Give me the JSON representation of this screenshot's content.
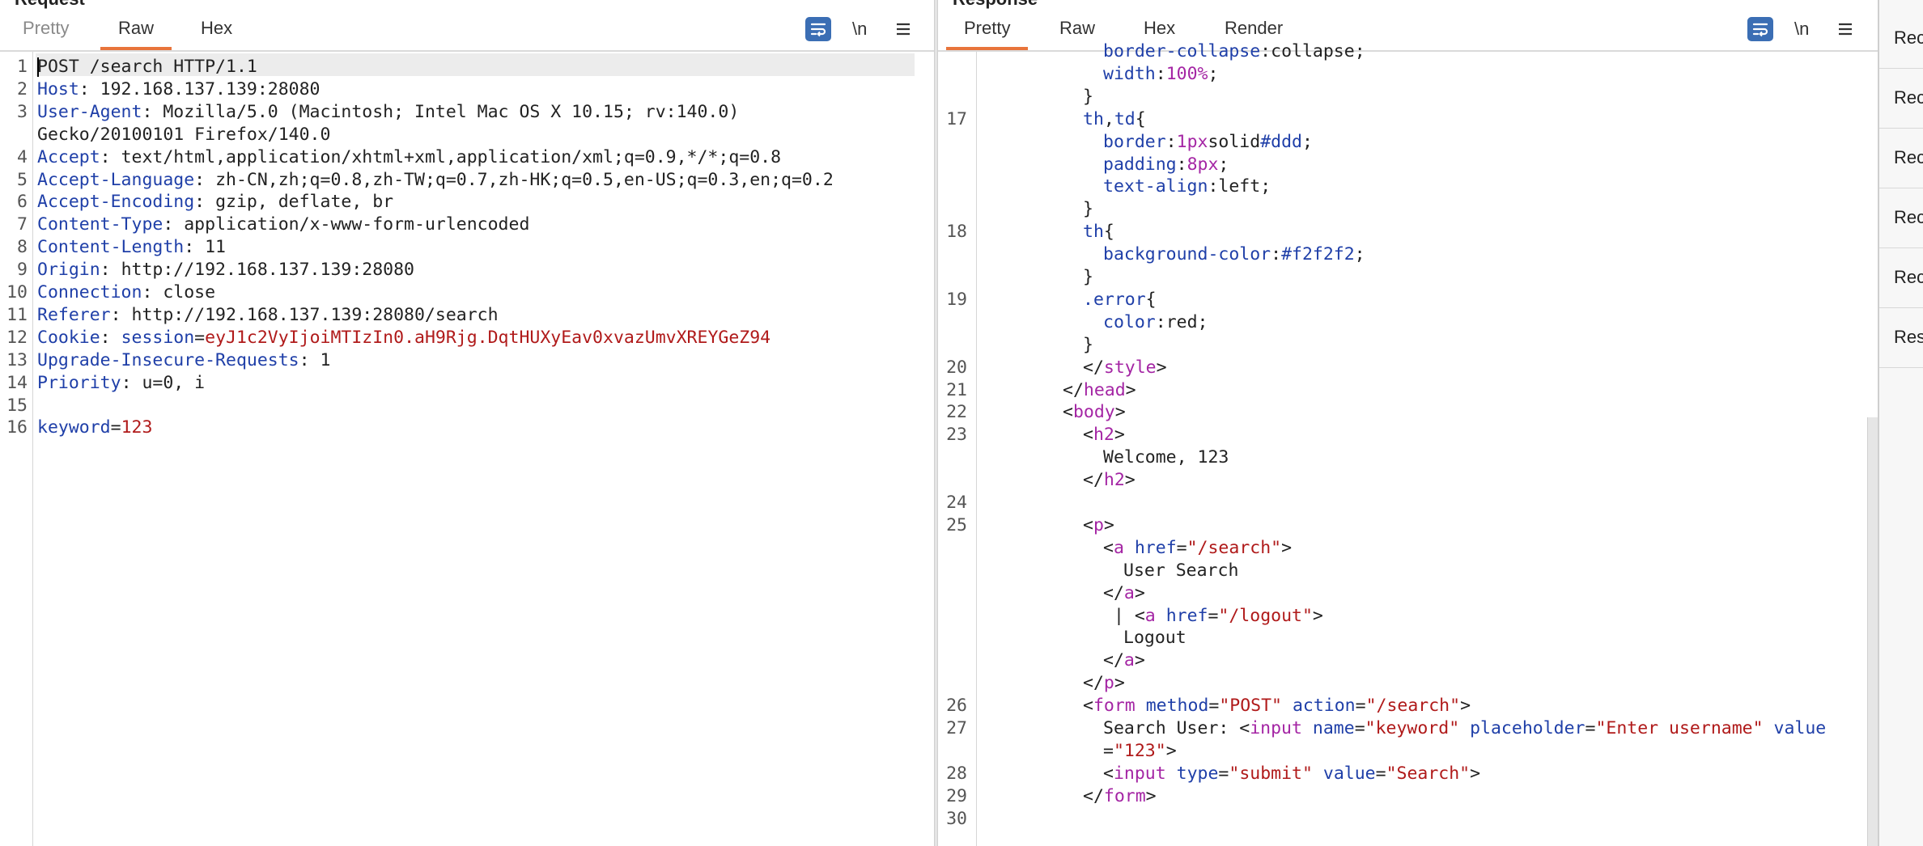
{
  "request": {
    "title": "Request",
    "tabs": [
      {
        "label": "Pretty",
        "active": false
      },
      {
        "label": "Raw",
        "active": true
      },
      {
        "label": "Hex",
        "active": false
      }
    ],
    "toolbar": {
      "wrap_icon": "wrap-lines-icon",
      "newline_label": "\\n",
      "menu_icon": "hamburger-menu-icon"
    },
    "lines": [
      {
        "n": "1",
        "text": "POST /search HTTP/1.1"
      },
      {
        "n": "2",
        "key": "Host",
        "value": "192.168.137.139:28080"
      },
      {
        "n": "3",
        "key": "User-Agent",
        "value": "Mozilla/5.0 (Macintosh; Intel Mac OS X 10.15; rv:140.0)"
      },
      {
        "n": "",
        "text": "Gecko/20100101 Firefox/140.0"
      },
      {
        "n": "4",
        "key": "Accept",
        "value": "text/html,application/xhtml+xml,application/xml;q=0.9,*/*;q=0.8"
      },
      {
        "n": "5",
        "key": "Accept-Language",
        "value": "zh-CN,zh;q=0.8,zh-TW;q=0.7,zh-HK;q=0.5,en-US;q=0.3,en;q=0.2"
      },
      {
        "n": "6",
        "key": "Accept-Encoding",
        "value": "gzip, deflate, br"
      },
      {
        "n": "7",
        "key": "Content-Type",
        "value": "application/x-www-form-urlencoded"
      },
      {
        "n": "8",
        "key": "Content-Length",
        "value": "11"
      },
      {
        "n": "9",
        "key": "Origin",
        "value": "http://192.168.137.139:28080"
      },
      {
        "n": "10",
        "key": "Connection",
        "value": "close"
      },
      {
        "n": "11",
        "key": "Referer",
        "value": "http://192.168.137.139:28080/search"
      },
      {
        "n": "12",
        "key": "Cookie",
        "cookie_name": "session",
        "cookie_value": "eyJ1c2VyIjoiMTIzIn0.aH9Rjg.DqtHUXyEav0xvazUmvXREYGeZ94"
      },
      {
        "n": "13",
        "key": "Upgrade-Insecure-Requests",
        "value": "1"
      },
      {
        "n": "14",
        "key": "Priority",
        "value": "u=0, i"
      },
      {
        "n": "15",
        "text": ""
      },
      {
        "n": "16",
        "param_name": "keyword",
        "param_value": "123"
      }
    ]
  },
  "response": {
    "title": "Response",
    "tabs": [
      {
        "label": "Pretty",
        "active": true
      },
      {
        "label": "Raw",
        "active": false
      },
      {
        "label": "Hex",
        "active": false
      },
      {
        "label": "Render",
        "active": false
      }
    ],
    "toolbar": {
      "wrap_icon": "wrap-lines-icon",
      "newline_label": "\\n",
      "menu_icon": "hamburger-menu-icon"
    },
    "lines": [
      {
        "n": "",
        "ind": 6,
        "parts": [
          [
            "p",
            "border-collapse"
          ],
          [
            "x",
            ":"
          ],
          [
            "v",
            "collapse"
          ],
          [
            "x",
            ";"
          ]
        ]
      },
      {
        "n": "",
        "ind": 6,
        "parts": [
          [
            "p",
            "width"
          ],
          [
            "x",
            ":"
          ],
          [
            "m",
            "100%"
          ],
          [
            "x",
            ";"
          ]
        ]
      },
      {
        "n": "",
        "ind": 5,
        "parts": [
          [
            "x",
            "}"
          ]
        ]
      },
      {
        "n": "17",
        "ind": 5,
        "parts": [
          [
            "s",
            "th"
          ],
          [
            "x",
            ","
          ],
          [
            "s",
            "td"
          ],
          [
            "x",
            "{"
          ]
        ]
      },
      {
        "n": "",
        "ind": 6,
        "parts": [
          [
            "p",
            "border"
          ],
          [
            "x",
            ":"
          ],
          [
            "m",
            "1px"
          ],
          [
            "v",
            "solid"
          ],
          [
            "h",
            "#ddd"
          ],
          [
            "x",
            ";"
          ]
        ]
      },
      {
        "n": "",
        "ind": 6,
        "parts": [
          [
            "p",
            "padding"
          ],
          [
            "x",
            ":"
          ],
          [
            "m",
            "8px"
          ],
          [
            "x",
            ";"
          ]
        ]
      },
      {
        "n": "",
        "ind": 6,
        "parts": [
          [
            "p",
            "text-align"
          ],
          [
            "x",
            ":"
          ],
          [
            "v",
            "left"
          ],
          [
            "x",
            ";"
          ]
        ]
      },
      {
        "n": "",
        "ind": 5,
        "parts": [
          [
            "x",
            "}"
          ]
        ]
      },
      {
        "n": "18",
        "ind": 5,
        "parts": [
          [
            "s",
            "th"
          ],
          [
            "x",
            "{"
          ]
        ]
      },
      {
        "n": "",
        "ind": 6,
        "parts": [
          [
            "p",
            "background-color"
          ],
          [
            "x",
            ":"
          ],
          [
            "h",
            "#f2f2f2"
          ],
          [
            "x",
            ";"
          ]
        ]
      },
      {
        "n": "",
        "ind": 5,
        "parts": [
          [
            "x",
            "}"
          ]
        ]
      },
      {
        "n": "19",
        "ind": 5,
        "parts": [
          [
            "s",
            ".error"
          ],
          [
            "x",
            "{"
          ]
        ]
      },
      {
        "n": "",
        "ind": 6,
        "parts": [
          [
            "p",
            "color"
          ],
          [
            "x",
            ":"
          ],
          [
            "v",
            "red"
          ],
          [
            "x",
            ";"
          ]
        ]
      },
      {
        "n": "",
        "ind": 5,
        "parts": [
          [
            "x",
            "}"
          ]
        ]
      },
      {
        "n": "20",
        "ind": 5,
        "parts": [
          [
            "x",
            "</"
          ],
          [
            "t",
            "style"
          ],
          [
            "x",
            ">"
          ]
        ]
      },
      {
        "n": "21",
        "ind": 4,
        "parts": [
          [
            "x",
            "</"
          ],
          [
            "t",
            "head"
          ],
          [
            "x",
            ">"
          ]
        ]
      },
      {
        "n": "22",
        "ind": 4,
        "parts": [
          [
            "x",
            "<"
          ],
          [
            "t",
            "body"
          ],
          [
            "x",
            ">"
          ]
        ]
      },
      {
        "n": "23",
        "ind": 5,
        "parts": [
          [
            "x",
            "<"
          ],
          [
            "t",
            "h2"
          ],
          [
            "x",
            ">"
          ]
        ]
      },
      {
        "n": "",
        "ind": 6,
        "parts": [
          [
            "x",
            "Welcome, 123"
          ]
        ]
      },
      {
        "n": "",
        "ind": 5,
        "parts": [
          [
            "x",
            "</"
          ],
          [
            "t",
            "h2"
          ],
          [
            "x",
            ">"
          ]
        ]
      },
      {
        "n": "24",
        "ind": 0,
        "parts": []
      },
      {
        "n": "25",
        "ind": 5,
        "parts": [
          [
            "x",
            "<"
          ],
          [
            "t",
            "p"
          ],
          [
            "x",
            ">"
          ]
        ]
      },
      {
        "n": "",
        "ind": 6,
        "parts": [
          [
            "x",
            "<"
          ],
          [
            "t",
            "a"
          ],
          [
            "x",
            " "
          ],
          [
            "a",
            "href"
          ],
          [
            "x",
            "="
          ],
          [
            "q",
            "\"/search\""
          ],
          [
            "x",
            ">"
          ]
        ]
      },
      {
        "n": "",
        "ind": 7,
        "parts": [
          [
            "x",
            "User Search"
          ]
        ]
      },
      {
        "n": "",
        "ind": 6,
        "parts": [
          [
            "x",
            "</"
          ],
          [
            "t",
            "a"
          ],
          [
            "x",
            ">"
          ]
        ]
      },
      {
        "n": "",
        "ind": 6,
        "parts": [
          [
            "x",
            " | <"
          ],
          [
            "t",
            "a"
          ],
          [
            "x",
            " "
          ],
          [
            "a",
            "href"
          ],
          [
            "x",
            "="
          ],
          [
            "q",
            "\"/logout\""
          ],
          [
            "x",
            ">"
          ]
        ]
      },
      {
        "n": "",
        "ind": 7,
        "parts": [
          [
            "x",
            "Logout"
          ]
        ]
      },
      {
        "n": "",
        "ind": 6,
        "parts": [
          [
            "x",
            "</"
          ],
          [
            "t",
            "a"
          ],
          [
            "x",
            ">"
          ]
        ]
      },
      {
        "n": "",
        "ind": 5,
        "parts": [
          [
            "x",
            "</"
          ],
          [
            "t",
            "p"
          ],
          [
            "x",
            ">"
          ]
        ]
      },
      {
        "n": "26",
        "ind": 5,
        "parts": [
          [
            "x",
            "<"
          ],
          [
            "t",
            "form"
          ],
          [
            "x",
            " "
          ],
          [
            "a",
            "method"
          ],
          [
            "x",
            "="
          ],
          [
            "q",
            "\"POST\""
          ],
          [
            "x",
            " "
          ],
          [
            "a",
            "action"
          ],
          [
            "x",
            "="
          ],
          [
            "q",
            "\"/search\""
          ],
          [
            "x",
            ">"
          ]
        ]
      },
      {
        "n": "27",
        "ind": 6,
        "parts": [
          [
            "x",
            "Search User: <"
          ],
          [
            "t",
            "input"
          ],
          [
            "x",
            " "
          ],
          [
            "a",
            "name"
          ],
          [
            "x",
            "="
          ],
          [
            "q",
            "\"keyword\""
          ],
          [
            "x",
            " "
          ],
          [
            "a",
            "placeholder"
          ],
          [
            "x",
            "="
          ],
          [
            "q",
            "\"Enter username\""
          ],
          [
            "x",
            " "
          ],
          [
            "a",
            "value"
          ]
        ]
      },
      {
        "n": "",
        "ind": 6,
        "parts": [
          [
            "x",
            "="
          ],
          [
            "q",
            "\"123\""
          ],
          [
            "x",
            ">"
          ]
        ]
      },
      {
        "n": "28",
        "ind": 6,
        "parts": [
          [
            "x",
            "<"
          ],
          [
            "t",
            "input"
          ],
          [
            "x",
            " "
          ],
          [
            "a",
            "type"
          ],
          [
            "x",
            "="
          ],
          [
            "q",
            "\"submit\""
          ],
          [
            "x",
            " "
          ],
          [
            "a",
            "value"
          ],
          [
            "x",
            "="
          ],
          [
            "q",
            "\"Search\""
          ],
          [
            "x",
            ">"
          ]
        ]
      },
      {
        "n": "29",
        "ind": 5,
        "parts": [
          [
            "x",
            "</"
          ],
          [
            "t",
            "form"
          ],
          [
            "x",
            ">"
          ]
        ]
      },
      {
        "n": "30",
        "ind": 0,
        "parts": []
      }
    ]
  },
  "side_strip": {
    "items": [
      "Rec",
      "Rec",
      "Rec",
      "Rec",
      "Rec",
      "Res"
    ]
  }
}
